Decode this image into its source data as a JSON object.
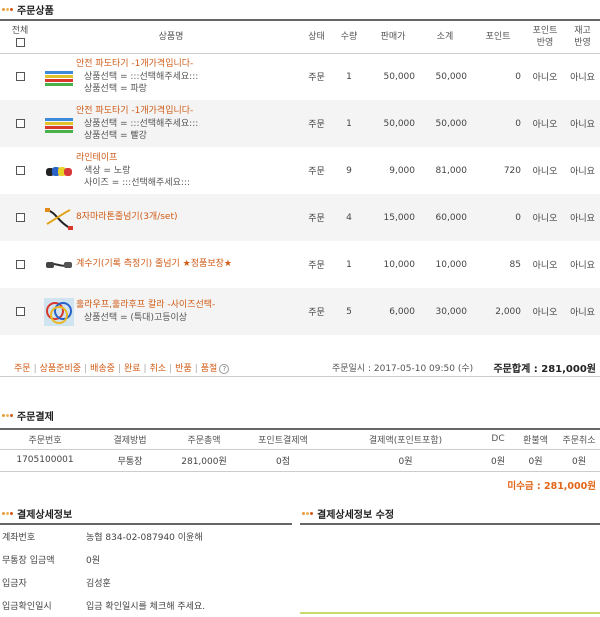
{
  "colors": {
    "accent": "#d05b16",
    "dot1": "#e89a3c",
    "dot2": "#f0b45a",
    "dot3": "#d45a1a",
    "unpaid": "#e2661a",
    "underline": "#c8dc6e"
  },
  "section_order": "주문상품",
  "headers": {
    "all": "전체",
    "product": "상품명",
    "status": "상태",
    "qty": "수량",
    "price": "판매가",
    "subtotal": "소계",
    "point": "포인트",
    "point_applied_1": "포인트",
    "point_applied_2": "반영",
    "stock_1": "재고",
    "stock_2": "반영"
  },
  "items": [
    {
      "name": "안전 파도타기 -1개가격입니다-",
      "opt1": "상품선택 = :::선택해주세요:::",
      "opt2": "상품선택 = 파랑",
      "status": "주문",
      "qty": "1",
      "price": "50,000",
      "subtotal": "50,000",
      "point": "0",
      "point_applied": "아니오",
      "stock_applied": "아니요",
      "icon": "jump-rope-bundle-icon"
    },
    {
      "name": "안전 파도타기 -1개가격입니다-",
      "opt1": "상품선택 = :::선택해주세요:::",
      "opt2": "상품선택 = 빨강",
      "status": "주문",
      "qty": "1",
      "price": "50,000",
      "subtotal": "50,000",
      "point": "0",
      "point_applied": "아니오",
      "stock_applied": "아니요",
      "icon": "jump-rope-bundle-icon"
    },
    {
      "name": "라인테이프",
      "opt1": "색상 = 노랑",
      "opt2": "사이즈 = :::선택해주세요:::",
      "status": "주문",
      "qty": "9",
      "price": "9,000",
      "subtotal": "81,000",
      "point": "720",
      "point_applied": "아니오",
      "stock_applied": "아니요",
      "icon": "tape-rolls-icon"
    },
    {
      "name": "8자마라톤줄넘기(3개/set)",
      "opt1": "",
      "opt2": "",
      "status": "주문",
      "qty": "4",
      "price": "15,000",
      "subtotal": "60,000",
      "point": "0",
      "point_applied": "아니오",
      "stock_applied": "아니요",
      "icon": "figure-eight-rope-icon"
    },
    {
      "name": "계수기(기록 측정기) 줄넘기 ★정품보장★",
      "opt1": "",
      "opt2": "",
      "status": "주문",
      "qty": "1",
      "price": "10,000",
      "subtotal": "10,000",
      "point": "85",
      "point_applied": "아니오",
      "stock_applied": "아니요",
      "icon": "counter-rope-icon"
    },
    {
      "name": "훌라우프,훌라후프 칼라 -사이즈선택-",
      "opt1": "상품선택 = (특대)고등이상",
      "opt2": "",
      "status": "주문",
      "qty": "5",
      "price": "6,000",
      "subtotal": "30,000",
      "point": "2,000",
      "point_applied": "아니오",
      "stock_applied": "아니요",
      "icon": "hula-hoop-icon"
    }
  ],
  "status_links": [
    "주문",
    "상품준비중",
    "배송중",
    "완료",
    "취소",
    "반품",
    "품절"
  ],
  "help_glyph": "?",
  "order_date": "주문일시 : 2017-05-10 09:50 (수)",
  "order_total": "주문합계 : 281,000원",
  "section_payment": "주문결제",
  "pay_headers": [
    "주문번호",
    "결제방법",
    "주문총액",
    "포인트결제액",
    "결제액(포인트포함)",
    "DC",
    "환불액",
    "주문취소"
  ],
  "pay_row": [
    "1705100001",
    "무통장",
    "281,000원",
    "0점",
    "0원",
    "0원",
    "0원",
    "0원"
  ],
  "unpaid": "미수금 : 281,000원",
  "section_detail": "결제상세정보",
  "section_detail_edit": "결제상세정보 수정",
  "detail_rows": [
    {
      "k": "계좌번호",
      "v": "농협 834-02-087940 이윤해"
    },
    {
      "k": "무통장 입금액",
      "v": "0원"
    },
    {
      "k": "입금자",
      "v": "김성훈"
    },
    {
      "k": "입금확인일시",
      "v": "입금 확인일시를 체크해 주세요."
    }
  ]
}
